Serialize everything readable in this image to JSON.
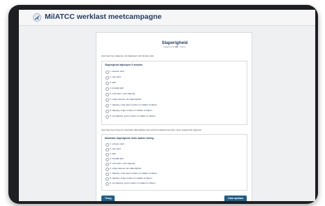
{
  "header": {
    "title": "MilATCC werklast meetcampagne",
    "logo_icon": "aircraft-icon"
  },
  "question": {
    "title": "Slaperigheid",
    "subtitle_prefix": "Vraagnummer",
    "subtitle_code": "###",
    "subtitle_suffix": "- Versie 1"
  },
  "section1": {
    "instruction": "Geef aan hoe slaperig u de afgelopen vijf minuten was:",
    "title": "Slaperigheid afgelopen 5 minuten",
    "options": [
      "1. extreem alert",
      "2. zeer alert",
      "3. alert",
      "4. tamelijk alert",
      "5. noch alert, noch slaperig",
      "6. enige tekenen van slaperigheid",
      "7. slaperig, maar geen moeite om wakker te blijven",
      "8. slaperig, enige moeite om wakker te blijven",
      "9. erg slaperig, grote moeite om wakker te blijven"
    ]
  },
  "section2": {
    "instruction": "Geef aan hoe hoog uw maximale slaperigheid was sinds de laatste keer dat u deze vraag heeft ingevuld:",
    "title": "Maximale slaperigheid sinds laatste meting",
    "options": [
      "1. extreem alert",
      "2. zeer alert",
      "3. alert",
      "4. tamelijk alert",
      "5. noch alert, noch slaperig",
      "6. enige tekenen van slaperigheid",
      "7. slaperig, maar geen moeite om wakker te blijven",
      "8. slaperig, enige moeite om wakker te blijven",
      "9. erg slaperig, grote moeite om wakker te blijven"
    ]
  },
  "buttons": {
    "back": "Terug",
    "save": "Data opslaan"
  },
  "colors": {
    "primary": "#1f5e8a",
    "heading": "#1f3d66",
    "device": "#1d1f22"
  }
}
